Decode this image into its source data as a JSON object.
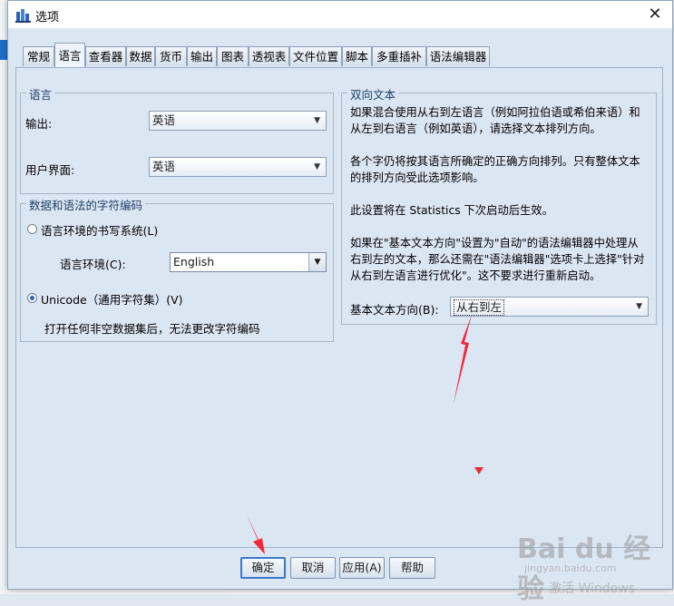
{
  "window": {
    "title": "选项",
    "close_glyph": "✕"
  },
  "tabs": [
    {
      "label": "常规"
    },
    {
      "label": "语言",
      "active": true
    },
    {
      "label": "查看器"
    },
    {
      "label": "数据"
    },
    {
      "label": "货币"
    },
    {
      "label": "输出"
    },
    {
      "label": "图表"
    },
    {
      "label": "透视表"
    },
    {
      "label": "文件位置"
    },
    {
      "label": "脚本"
    },
    {
      "label": "多重插补"
    },
    {
      "label": "语法编辑器"
    }
  ],
  "language_group": {
    "legend": "语言",
    "output_label": "输出:",
    "output_value": "英语",
    "ui_label": "用户界面:",
    "ui_value": "英语"
  },
  "encoding_group": {
    "legend": "数据和语法的字符编码",
    "locale_radio_label": "语言环境的书写系统(L)",
    "locale_label": "语言环境(C):",
    "locale_value": "English",
    "unicode_radio_label": "Unicode（通用字符集）(V)",
    "note": "打开任何非空数据集后，无法更改字符编码",
    "selected": "unicode"
  },
  "bidi_group": {
    "legend": "双向文本",
    "para1": "如果混合使用从右到左语言（例如阿拉伯语或希伯来语）和从左到右语言（例如英语），请选择文本排列方向。",
    "para2": "各个字仍将按其语言所确定的正确方向排列。只有整体文本的排列方向受此选项影响。",
    "para3": "此设置将在 Statistics 下次启动后生效。",
    "para4": "如果在\"基本文本方向\"设置为\"自动\"的语法编辑器中处理从右到左的文本，那么还需在\"语法编辑器\"选项卡上选择\"针对从右到左语言进行优化\"。这不要求进行重新启动。",
    "direction_label": "基本文本方向(B):",
    "direction_value": "从右到左"
  },
  "buttons": {
    "ok": "确定",
    "cancel": "取消",
    "apply": "应用(A)",
    "help": "帮助"
  },
  "watermark": {
    "brand": "Bai du 经验",
    "url": "jingyan.baidu.com",
    "activate": "激活 Windows"
  },
  "colors": {
    "accent": "#3b78c8",
    "annotation": "#f0283c",
    "panel": "#dbe6f3"
  }
}
